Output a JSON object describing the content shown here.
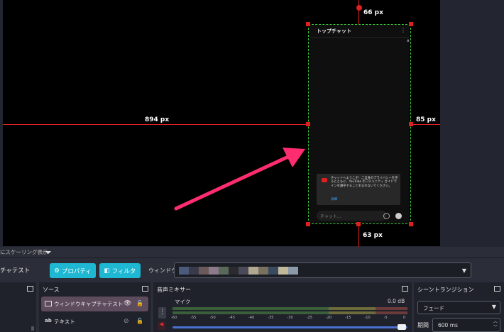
{
  "preview": {
    "measure_top": "66 px",
    "measure_left": "894 px",
    "measure_right": "85 px",
    "measure_bottom": "63 px"
  },
  "chat": {
    "title": "トップチャット",
    "notice": "チャットへようこそ！ご自身のプライバシーを守るとともに、YouTube のコミュニティ ガイドラインを遵守することを忘れないでください。",
    "notice_link": "詳細",
    "input_placeholder": "チャット..."
  },
  "status_bar": {
    "scaling_label": "にスケーリング表示"
  },
  "toolbar": {
    "source_name": "チャテスト",
    "properties_label": "プロパティ",
    "filters_label": "フィルタ",
    "window_label": "ウィンドウ",
    "window_swatches": [
      "#4a5a7a",
      "#3a3a48",
      "#6a5a5a",
      "#8a7a8a",
      "#5a6a5a",
      "#2a2a30",
      "#4a4a58",
      "#b0a890",
      "#7a7060",
      "#3a4a60",
      "#c0b898",
      "#8a9aa8"
    ]
  },
  "sources": {
    "title": "ソース",
    "items": [
      {
        "label": "ウィンドウキャプチャテスト"
      },
      {
        "label": "テキスト"
      }
    ]
  },
  "mixer": {
    "title": "音声ミキサー",
    "channel_label": "マイク",
    "channel_db": "0.0 dB",
    "ticks": [
      "-60",
      "-55",
      "-50",
      "-45",
      "-40",
      "-35",
      "-30",
      "-25",
      "-20",
      "-15",
      "-10",
      "-5",
      "0"
    ]
  },
  "transitions": {
    "title": "シーントランジション",
    "selected": "フェード",
    "duration_label": "期間",
    "duration_value": "600 ms"
  },
  "colors": {
    "accent": "#1eb8d3",
    "selection_red": "#e02020",
    "bounding_green": "#3cc83c",
    "arrow_pink": "#ff2d6f"
  }
}
